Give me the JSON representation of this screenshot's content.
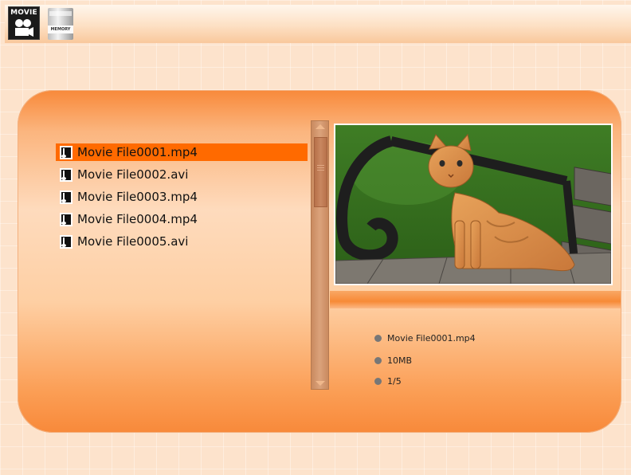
{
  "header": {
    "mode_label": "MOVIE",
    "mode_icon": "movie-camera-icon",
    "storage_label": "MEMORY",
    "storage_icon": "memory-card-icon"
  },
  "file_list": {
    "items": [
      {
        "name": "Movie File0001.mp4",
        "selected": true
      },
      {
        "name": "Movie File0002.avi",
        "selected": false
      },
      {
        "name": "Movie File0003.mp4",
        "selected": false
      },
      {
        "name": "Movie File0004.mp4",
        "selected": false
      },
      {
        "name": "Movie File0005.avi",
        "selected": false
      }
    ],
    "item_icon": "music-file-icon",
    "selection_color": "#ff6a00"
  },
  "preview": {
    "image_subject": "orange tabby cat sitting on a park bench"
  },
  "details": {
    "filename": "Movie File0001.mp4",
    "size": "10MB",
    "position": "1/5"
  },
  "colors": {
    "panel_orange": "#f8893a",
    "background": "#fde3cc"
  }
}
